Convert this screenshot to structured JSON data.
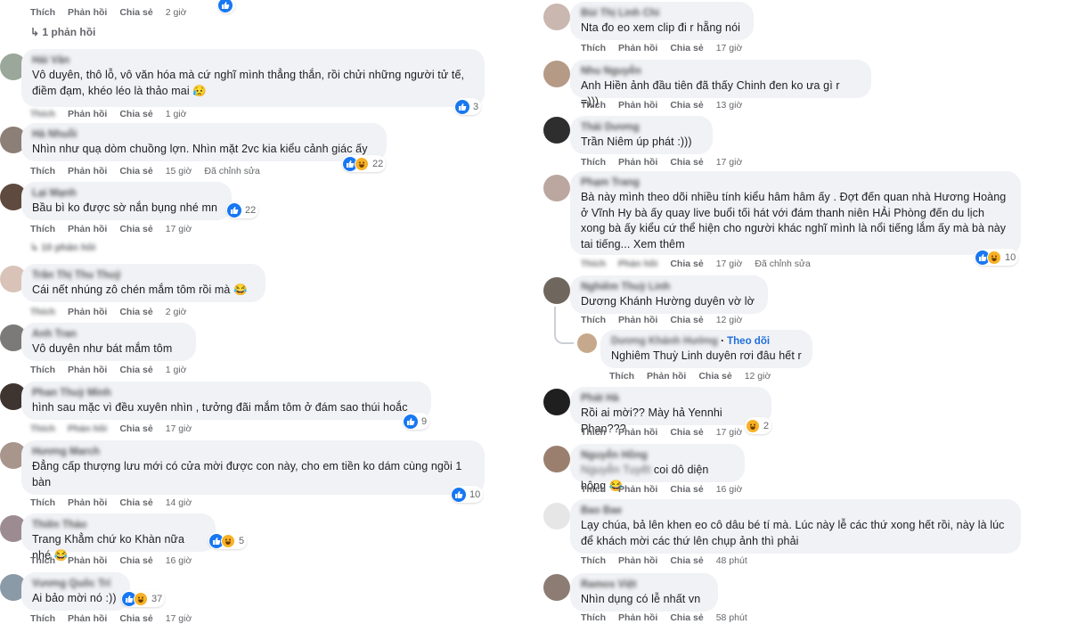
{
  "left": {
    "top_actions": {
      "like": "Thích",
      "reply": "Phản hồi",
      "share": "Chia sẻ",
      "time": "2 giờ"
    },
    "replies_link": "1 phản hồi",
    "comments": [
      {
        "name": "Hải Văn",
        "text": "Vô duyên, thô lỗ, vô văn hóa mà cứ nghĩ mình thẳng thắn, rồi chửi những người tử tế, điềm đạm, khéo léo là thảo mai 😥",
        "like": "Thích",
        "reply": "Phản hồi",
        "share": "Chia sẻ",
        "time": "1 giờ",
        "reactions": "3"
      },
      {
        "name": "Hà Nhuỗi",
        "text": "Nhìn như quạ dòm chuồng lợn. Nhìn mặt 2vc kia kiểu cảnh giác ấy",
        "like": "Thích",
        "reply": "Phản hồi",
        "share": "Chia sẻ",
        "time": "15 giờ",
        "edited": "Đã chỉnh sửa",
        "reactions": "22"
      },
      {
        "name": "Lại Mạnh",
        "text": "Bầu bì ko được sờ nắn bụng nhé mn",
        "like": "Thích",
        "reply": "Phản hồi",
        "share": "Chia sẻ",
        "time": "17 giờ",
        "reactions": "22"
      },
      {
        "name": "Trần Thị Thu Thuỷ",
        "text": "Cái nết nhúng zô chén mắm tôm rồi mà 😂",
        "like": "Thích",
        "reply": "Phản hồi",
        "share": "Chia sẻ",
        "time": "2 giờ"
      },
      {
        "name": "Anh Tran",
        "text": "Vô duyên như bát mắm tôm",
        "like": "Thích",
        "reply": "Phản hồi",
        "share": "Chia sẻ",
        "time": "1 giờ"
      },
      {
        "name": "Phan Thuỳ Minh",
        "text": "hình sau mặc vì đều xuyên nhìn , tưởng đãi mắm tôm ở đám sao thúi hoắc",
        "like": "Thích",
        "reply": "Phản hồi",
        "share": "Chia sẻ",
        "time": "17 giờ",
        "reactions": "9"
      },
      {
        "name": "Hương March",
        "text": "Đẳng cấp thượng lưu mới có cửa mời được con này, cho em tiền ko dám cùng ngồi 1 bàn",
        "like": "Thích",
        "reply": "Phản hồi",
        "share": "Chia sẻ",
        "time": "14 giờ",
        "reactions": "10"
      },
      {
        "name": "Thiên Thảo",
        "text": "Trang Khẳm chứ ko Khàn nữa nhé 😂",
        "like": "Thích",
        "reply": "Phản hồi",
        "share": "Chia sẻ",
        "time": "16 giờ",
        "reactions": "5"
      },
      {
        "name": "Vương Quốc Trí",
        "text": "Ai bảo mời nó :))",
        "like": "Thích",
        "reply": "Phản hồi",
        "share": "Chia sẻ",
        "time": "17 giờ",
        "reactions": "37"
      }
    ],
    "hidden_replies": "10 phản hồi"
  },
  "right": {
    "comments": [
      {
        "name": "Bùi Thị Linh Chi",
        "text": "Nta đo eo xem clip đi r hẵng nói",
        "like": "Thích",
        "reply": "Phản hồi",
        "share": "Chia sẻ",
        "time": "17 giờ"
      },
      {
        "name": "Nhu Nguyễn",
        "text": "Anh Hiền ảnh đầu tiên đã thấy Chinh đen ko ưa gì r =)))",
        "like": "Thích",
        "reply": "Phản hồi",
        "share": "Chia sẻ",
        "time": "13 giờ"
      },
      {
        "name": "Thái Dương",
        "text": "Trần Niêm úp phát :)))",
        "like": "Thích",
        "reply": "Phản hồi",
        "share": "Chia sẻ",
        "time": "17 giờ"
      },
      {
        "name": "Phạm Trang",
        "text": "Bà này mình theo dõi nhiều tính kiểu hâm hâm ấy . Đợt đến quan nhà Hương Hoàng ở Vĩnh Hy bà ấy quay live buổi tối hát với đám thanh niên HẢi Phòng đến du lịch xong bà ấy kiểu cứ thể hiện cho người khác nghĩ mình là nổi tiếng lắm ấy mà bà này tai tiếng... Xem thêm",
        "like": "Thích",
        "reply": "Phản hồi",
        "share": "Chia sẻ",
        "time": "17 giờ",
        "edited": "Đã chỉnh sửa",
        "reactions": "10"
      },
      {
        "name": "Nghiêm Thuỳ Linh",
        "text": "Dương Khánh Hường duyên vờ lờ",
        "like": "Thích",
        "reply": "Phản hồi",
        "share": "Chia sẻ",
        "time": "12 giờ"
      },
      {
        "name": "Dương Khánh Hường",
        "follow": "Theo dõi",
        "text": "Nghiêm Thuỳ Linh duyên rơi đâu hết r",
        "like": "Thích",
        "reply": "Phản hồi",
        "share": "Chia sẻ",
        "time": "12 giờ"
      },
      {
        "name": "Phát Hà",
        "text": "Rồi ai mời?? Mày hả Yennhi Phan???",
        "like": "Thích",
        "reply": "Phản hồi",
        "share": "Chia sẻ",
        "time": "17 giờ",
        "reactions": "2"
      },
      {
        "name": "Nguyễn Hồng",
        "text": "Nguyễn Tuyết coi dô diện hông 😂",
        "like": "Thích",
        "reply": "Phản hồi",
        "share": "Chia sẻ",
        "time": "16 giờ"
      },
      {
        "name": "Bao Bae",
        "text": "Lạy chúa, bả lên khen eo cô dâu bé tí mà. Lúc này lễ các thứ xong hết rồi, này là lúc để khách mời các thứ lên chụp ảnh thì phải",
        "like": "Thích",
        "reply": "Phản hồi",
        "share": "Chia sẻ",
        "time": "48 phút"
      },
      {
        "name": "Ramos Việt",
        "text": "Nhìn dụng có lễ nhất vn",
        "like": "Thích",
        "reply": "Phản hồi",
        "share": "Chia sẻ",
        "time": "58 phút"
      }
    ]
  },
  "colors": {
    "bubble": "#f0f2f5",
    "meta": "#65676b",
    "like": "#1877f2",
    "haha": "#f7b125",
    "link": "#385898"
  }
}
